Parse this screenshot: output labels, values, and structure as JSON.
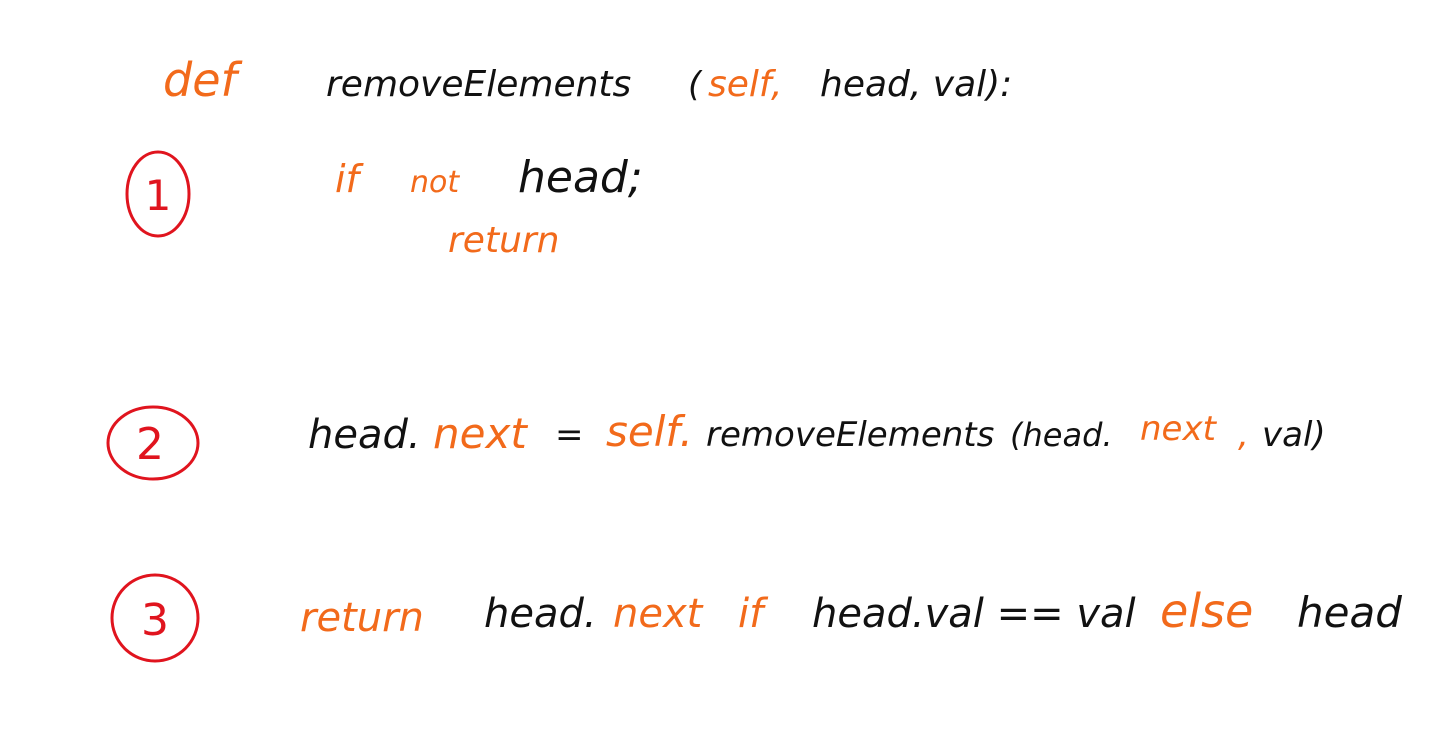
{
  "colors": {
    "keyword": "#f26a1b",
    "text": "#111111",
    "step_marker": "#e0141e",
    "background": "#ffffff"
  },
  "line_def": {
    "keyword_def": "def",
    "function_name": "removeElements",
    "open_paren": "(",
    "param_self": "self,",
    "params_rest": "head, val):"
  },
  "step1": {
    "marker": "1",
    "keyword_if": "if",
    "keyword_not": "not",
    "condition": "head;",
    "keyword_return": "return"
  },
  "step2": {
    "marker": "2",
    "target": "head.",
    "attr_next": "next",
    "assign": "=",
    "self_ref": "self.",
    "call": "removeElements",
    "arg_open": "(head.",
    "arg_next": "next",
    "arg_comma": ",",
    "arg_rest": "val)"
  },
  "step3": {
    "marker": "3",
    "keyword_return": "return",
    "obj": "head.",
    "attr_next": "next",
    "keyword_if": "if",
    "condition": "head.val == val",
    "keyword_else": "else",
    "fallback": "head"
  }
}
